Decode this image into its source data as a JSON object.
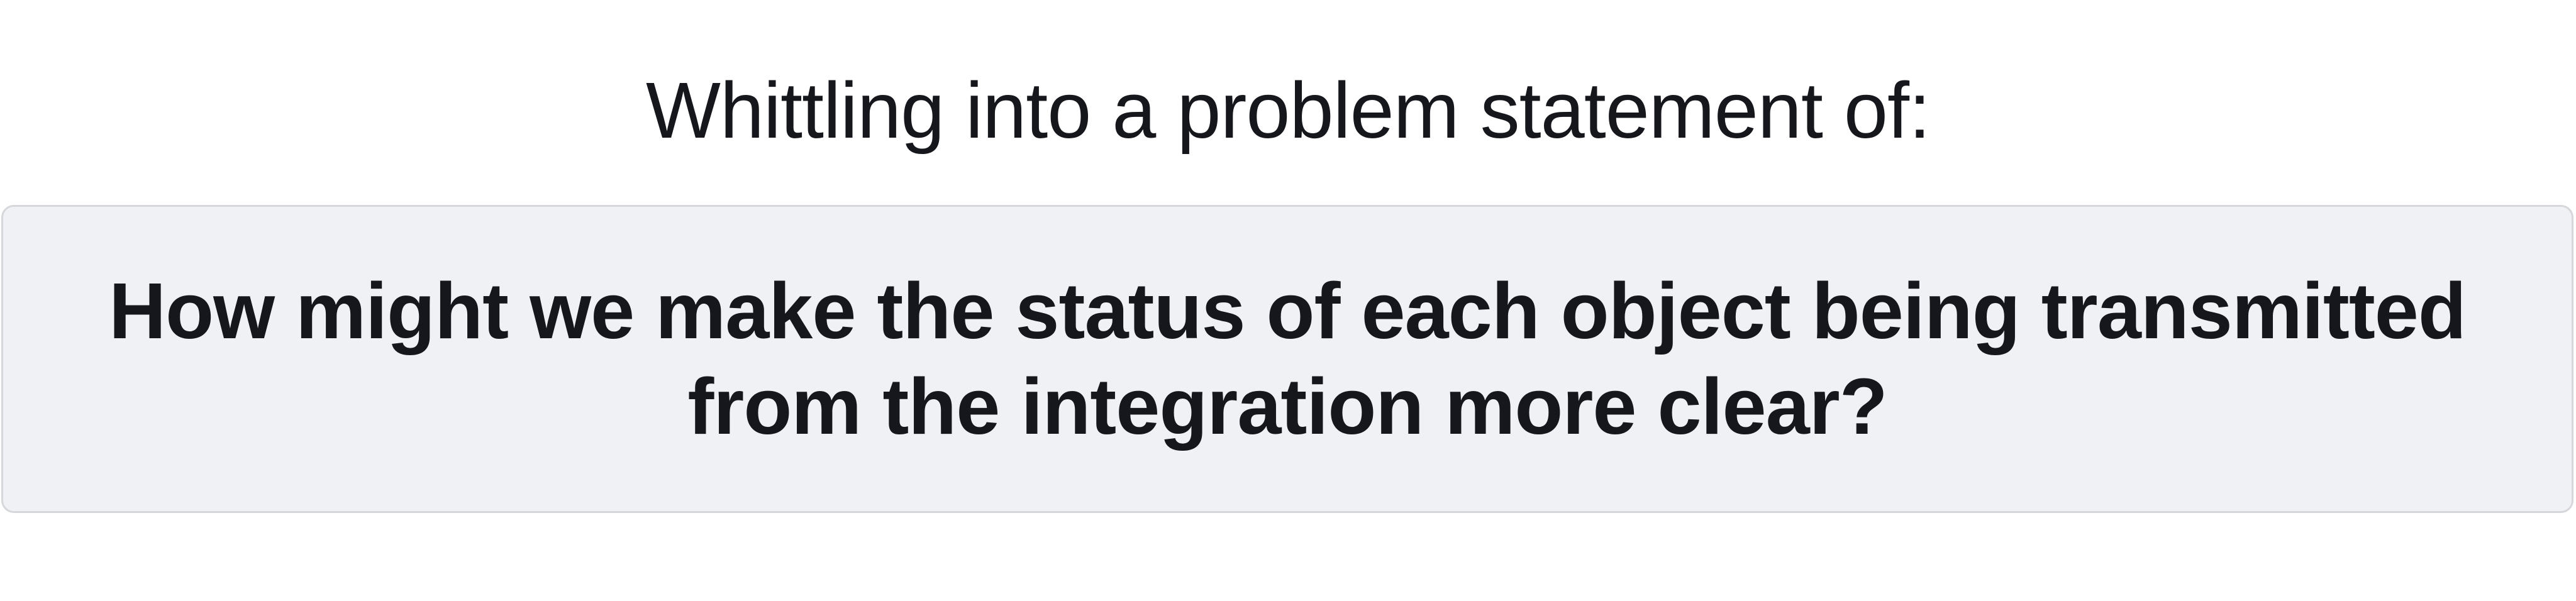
{
  "intro_text": "Whittling into a problem statement of:",
  "problem_statement": "How might we make the status of each object being transmitted from the integration more clear?",
  "colors": {
    "text": "#15171c",
    "box_background": "#f0f1f4",
    "box_border": "#d6d7db",
    "page_background": "#ffffff"
  }
}
